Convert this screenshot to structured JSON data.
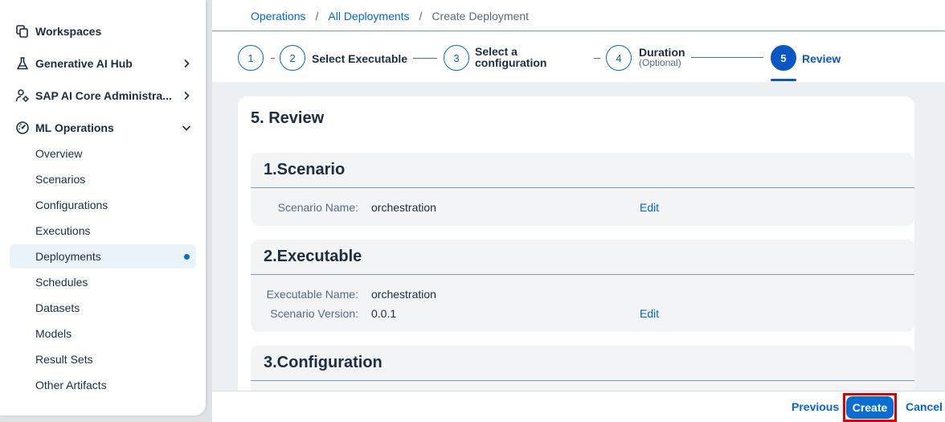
{
  "sidebar": {
    "items": [
      {
        "label": "Workspaces",
        "icon": "workspaces-icon"
      },
      {
        "label": "Generative AI Hub",
        "icon": "flask-icon"
      },
      {
        "label": "SAP AI Core Administra...",
        "icon": "user-settings-icon"
      },
      {
        "label": "ML Operations",
        "icon": "gauge-icon"
      }
    ],
    "sub_items": [
      "Overview",
      "Scenarios",
      "Configurations",
      "Executions",
      "Deployments",
      "Schedules",
      "Datasets",
      "Models",
      "Result Sets",
      "Other Artifacts"
    ],
    "active_sub_item": "Deployments"
  },
  "breadcrumb": {
    "items": [
      "Operations",
      "All Deployments"
    ],
    "separator": "/",
    "current": "Create Deployment"
  },
  "wizard": {
    "steps": [
      {
        "number": "1",
        "label": ""
      },
      {
        "number": "2",
        "label": "Select Executable"
      },
      {
        "number": "3",
        "label_line1": "Select a",
        "label_line2": "configuration"
      },
      {
        "number": "4",
        "label": "Duration",
        "sublabel": "(Optional)"
      },
      {
        "number": "5",
        "label": "Review"
      }
    ],
    "current_step": 5
  },
  "review": {
    "title": "5. Review",
    "scenario": {
      "title": "1.Scenario",
      "name_label": "Scenario Name:",
      "name_value": "orchestration",
      "edit": "Edit"
    },
    "executable": {
      "title": "2.Executable",
      "name_label": "Executable Name:",
      "name_value": "orchestration",
      "version_label": "Scenario Version:",
      "version_value": "0.0.1",
      "edit": "Edit"
    },
    "configuration": {
      "title": "3.Configuration"
    }
  },
  "footer": {
    "previous": "Previous",
    "create": "Create",
    "cancel": "Cancel"
  },
  "colors": {
    "accent": "#0a6ed1",
    "link": "#0064d9",
    "highlight_outline": "#e00000"
  }
}
